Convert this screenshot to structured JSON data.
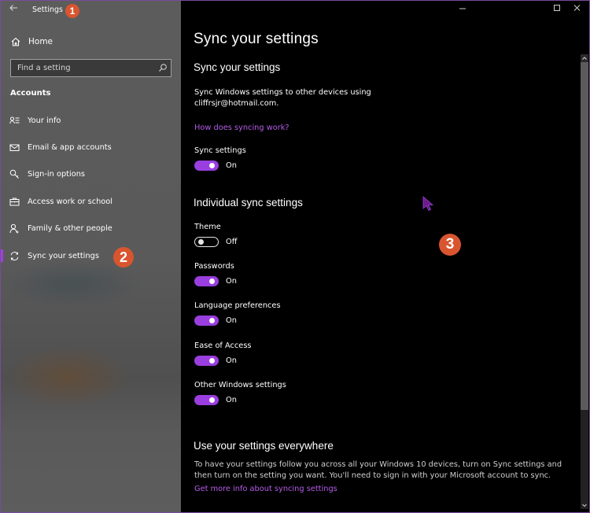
{
  "window": {
    "title": "Settings",
    "controls": [
      "minimize",
      "maximize",
      "close"
    ]
  },
  "annotations": {
    "badge1": "1",
    "badge2": "2",
    "badge3": "3"
  },
  "sidebar": {
    "home_label": "Home",
    "search": {
      "placeholder": "Find a setting",
      "value": ""
    },
    "section_label": "Accounts",
    "items": [
      {
        "label": "Your info",
        "icon": "contact-info-icon"
      },
      {
        "label": "Email & app accounts",
        "icon": "mail-icon"
      },
      {
        "label": "Sign-in options",
        "icon": "key-icon"
      },
      {
        "label": "Access work or school",
        "icon": "briefcase-icon"
      },
      {
        "label": "Family & other people",
        "icon": "add-person-icon"
      },
      {
        "label": "Sync your settings",
        "icon": "sync-icon",
        "selected": true
      }
    ]
  },
  "main": {
    "page_title": "Sync your settings",
    "sync_section": {
      "heading": "Sync your settings",
      "description_line1": "Sync Windows settings to other devices using",
      "description_line2": "cliffrsjr@hotmail.com.",
      "link": "How does syncing work?",
      "setting": {
        "label": "Sync settings",
        "state": "On",
        "on": true
      }
    },
    "individual_section": {
      "heading": "Individual sync settings",
      "settings": [
        {
          "label": "Theme",
          "state": "Off",
          "on": false
        },
        {
          "label": "Passwords",
          "state": "On",
          "on": true
        },
        {
          "label": "Language preferences",
          "state": "On",
          "on": true
        },
        {
          "label": "Ease of Access",
          "state": "On",
          "on": true
        },
        {
          "label": "Other Windows settings",
          "state": "On",
          "on": true
        }
      ]
    },
    "everywhere_section": {
      "heading": "Use your settings everywhere",
      "description": "To have your settings follow you across all your Windows 10 devices, turn on Sync settings and then turn on the setting you want. You'll need to sign in with your Microsoft account to sync.",
      "link": "Get more info about syncing settings"
    }
  },
  "colors": {
    "accent": "#9a3ee0",
    "link": "#b55ce8",
    "badge": "#d9552f",
    "window_border": "#7a4a9a"
  }
}
